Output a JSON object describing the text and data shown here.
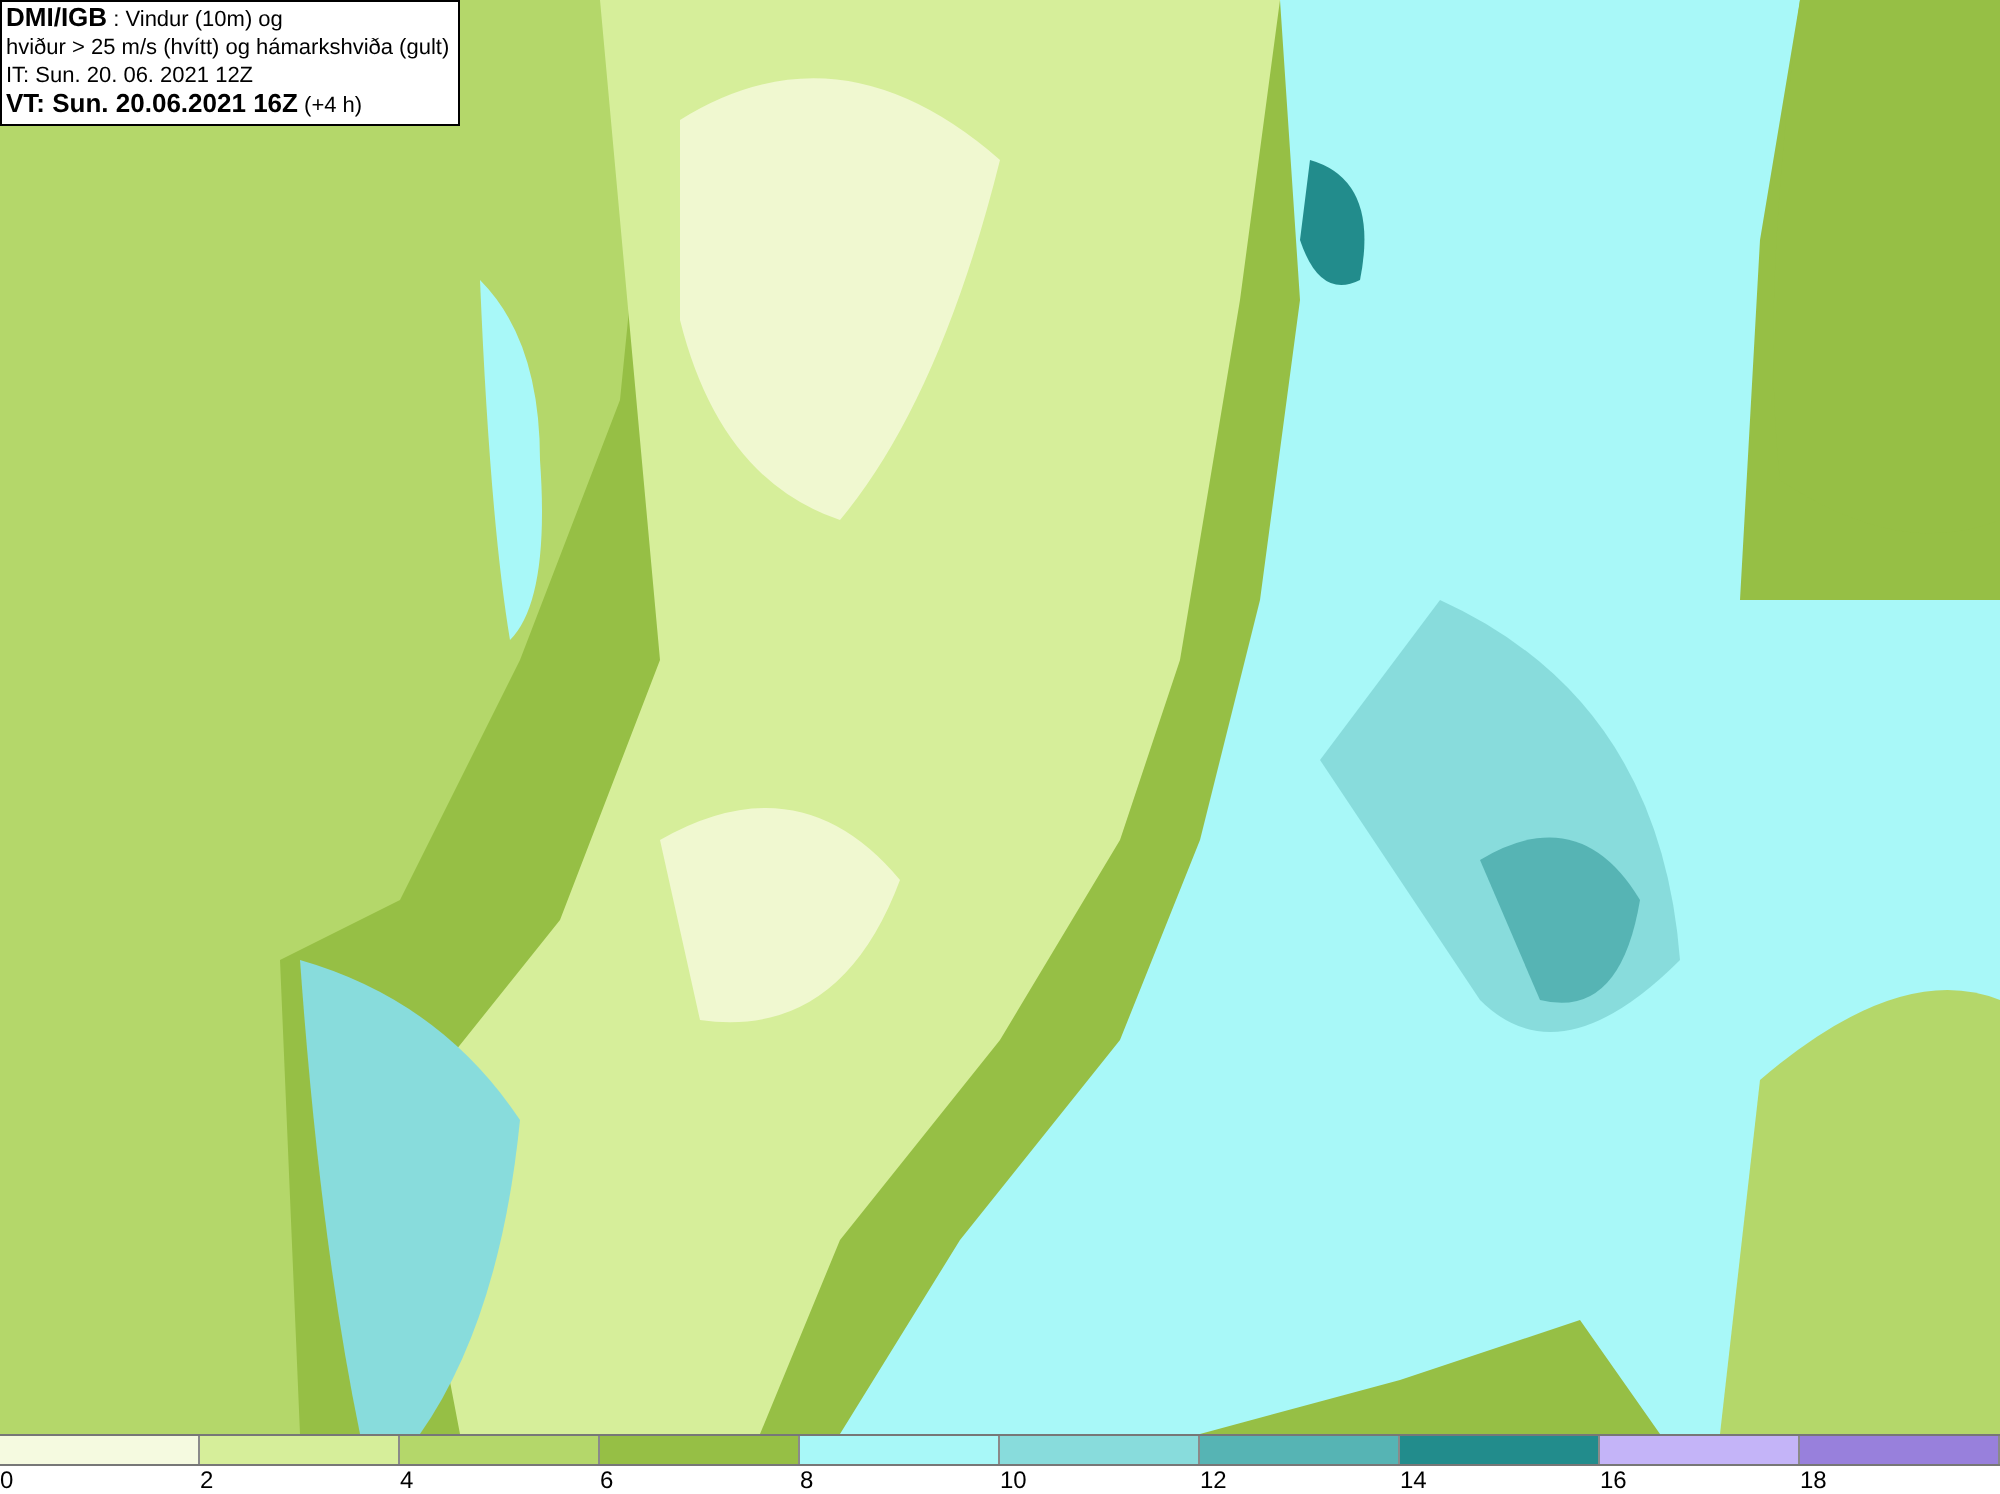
{
  "title_box": {
    "lines": [
      "**DMI/IGB** : Vindur (10m) og",
      "hviður > 25 m/s (hvítt) og hámarkshviða (gult)",
      "IT: Sun. 20. 06. 2021 12Z",
      "**VT: Sun. 20.06.2021 16Z** (+4 h)"
    ]
  },
  "legend": {
    "segments": [
      {
        "color": "#f5fae0"
      },
      {
        "color": "#d6ee9a"
      },
      {
        "color": "#b4d76a"
      },
      {
        "color": "#96bf45"
      },
      {
        "color": "#a8f8f8"
      },
      {
        "color": "#88dcdc"
      },
      {
        "color": "#56b4b4"
      },
      {
        "color": "#228c8c"
      },
      {
        "color": "#c4b4f8"
      },
      {
        "color": "#9880dc"
      }
    ],
    "ticks": [
      "0",
      "2",
      "4",
      "6",
      "8",
      "10",
      "12",
      "14",
      "16",
      "18"
    ]
  }
}
